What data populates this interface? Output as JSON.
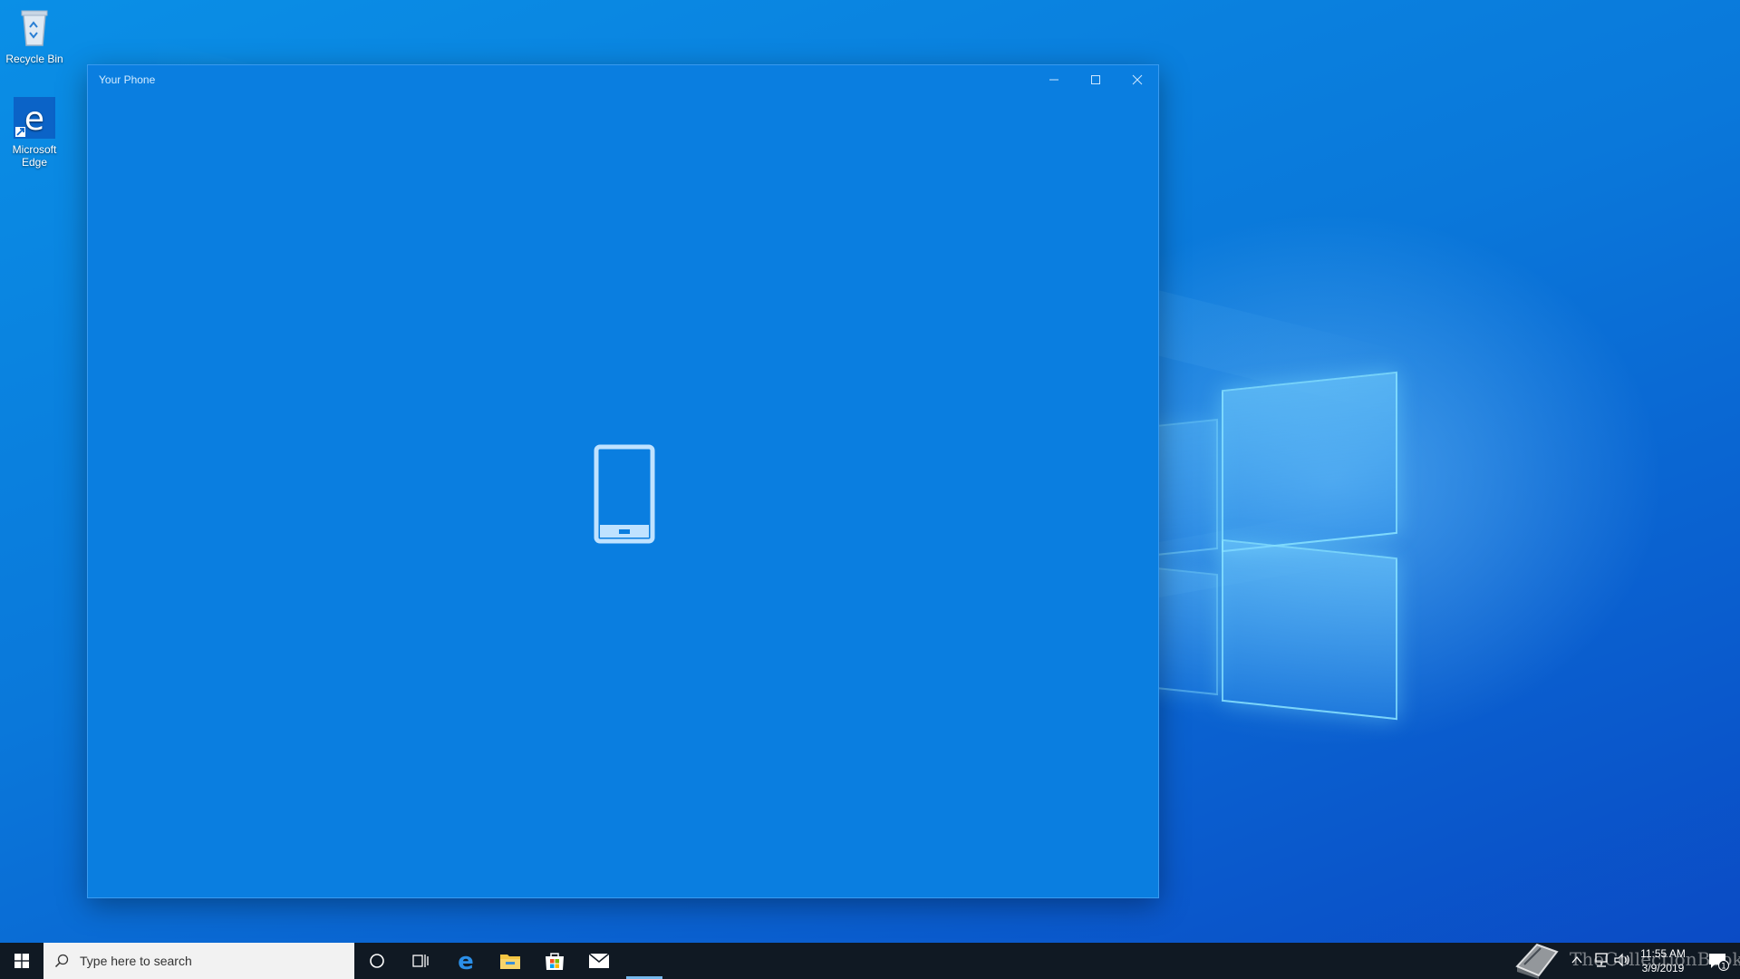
{
  "desktop": {
    "icons": [
      {
        "label": "Recycle Bin",
        "icon": "recycle-bin-icon"
      },
      {
        "label": "Microsoft Edge",
        "icon": "edge-icon"
      }
    ]
  },
  "window": {
    "title": "Your Phone",
    "controls": {
      "minimize": "minimize-icon",
      "maximize": "maximize-icon",
      "close": "close-icon"
    },
    "content_icon": "phone-icon",
    "background": "#0a7ee0"
  },
  "taskbar": {
    "search_placeholder": "Type here to search",
    "pinned": [
      "cortana-icon",
      "task-view-icon",
      "edge-icon",
      "file-explorer-icon",
      "store-icon",
      "mail-icon"
    ],
    "watermark": "TheCollectionBook",
    "time": "11:55 AM",
    "date": "3/9/2019",
    "notification_count": "1",
    "background": "#101923"
  },
  "colors": {
    "accent": "#0078d7",
    "taskbar_indicator": "#76b9ed"
  }
}
